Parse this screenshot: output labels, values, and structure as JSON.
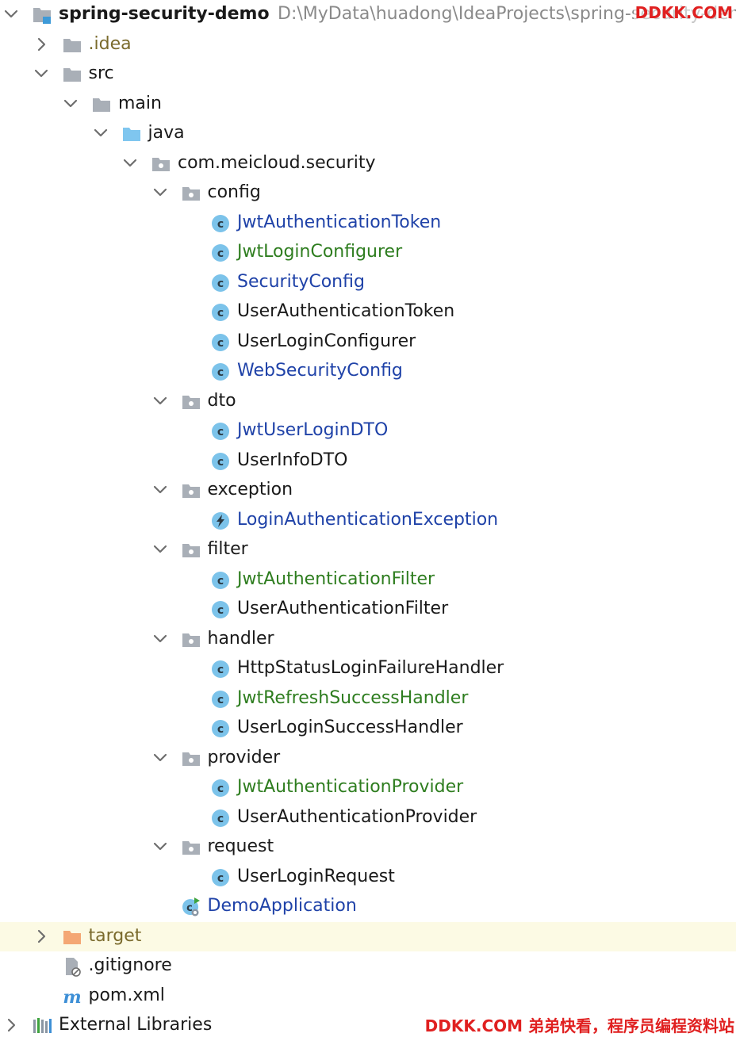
{
  "colors": {
    "default": "#1a1a1a",
    "modified": "#1f42a8",
    "added": "#2e7d1f",
    "excluded": "#7a6a2c",
    "path": "#8a8a8a",
    "row_highlight": "#fcfae4",
    "class_icon": "#7cc3ea",
    "folder": "#a9afb7",
    "source_folder": "#7fc6ef",
    "excluded_folder": "#f4a774",
    "watermark": "#e02020"
  },
  "project": {
    "name": "spring-security-demo",
    "path": "D:\\MyData\\huadong\\IdeaProjects\\spring-security-demo"
  },
  "watermark": {
    "top": "DDKK.COM",
    "bottom": "DDKK.COM 弟弟快看，程序员编程资料站"
  },
  "nodes": [
    {
      "label": "spring-security-demo",
      "depth": 0,
      "expander": "open",
      "icon": "module-folder-icon",
      "color": "default",
      "bold": true,
      "name": "project-root"
    },
    {
      "label": ".idea",
      "depth": 1,
      "expander": "closed",
      "icon": "folder-icon",
      "color": "excluded",
      "name": "tree-item-idea"
    },
    {
      "label": "src",
      "depth": 1,
      "expander": "open",
      "icon": "folder-icon",
      "color": "default",
      "name": "tree-item-src"
    },
    {
      "label": "main",
      "depth": 2,
      "expander": "open",
      "icon": "folder-icon",
      "color": "default",
      "name": "tree-item-main"
    },
    {
      "label": "java",
      "depth": 3,
      "expander": "open",
      "icon": "source-folder-icon",
      "color": "default",
      "name": "tree-item-java"
    },
    {
      "label": "com.meicloud.security",
      "depth": 4,
      "expander": "open",
      "icon": "package-icon",
      "color": "default",
      "name": "tree-item-package-root"
    },
    {
      "label": "config",
      "depth": 5,
      "expander": "open",
      "icon": "package-icon",
      "color": "default",
      "name": "tree-item-config"
    },
    {
      "label": "JwtAuthenticationToken",
      "depth": 6,
      "expander": "none",
      "icon": "class-icon",
      "color": "modified",
      "name": "tree-item-class"
    },
    {
      "label": "JwtLoginConfigurer",
      "depth": 6,
      "expander": "none",
      "icon": "class-icon",
      "color": "added",
      "name": "tree-item-class"
    },
    {
      "label": "SecurityConfig",
      "depth": 6,
      "expander": "none",
      "icon": "class-icon",
      "color": "modified",
      "name": "tree-item-class"
    },
    {
      "label": "UserAuthenticationToken",
      "depth": 6,
      "expander": "none",
      "icon": "class-icon",
      "color": "default",
      "name": "tree-item-class"
    },
    {
      "label": "UserLoginConfigurer",
      "depth": 6,
      "expander": "none",
      "icon": "class-icon",
      "color": "default",
      "name": "tree-item-class"
    },
    {
      "label": "WebSecurityConfig",
      "depth": 6,
      "expander": "none",
      "icon": "class-icon",
      "color": "modified",
      "name": "tree-item-class"
    },
    {
      "label": "dto",
      "depth": 5,
      "expander": "open",
      "icon": "package-icon",
      "color": "default",
      "name": "tree-item-dto"
    },
    {
      "label": "JwtUserLoginDTO",
      "depth": 6,
      "expander": "none",
      "icon": "class-icon",
      "color": "modified",
      "name": "tree-item-class"
    },
    {
      "label": "UserInfoDTO",
      "depth": 6,
      "expander": "none",
      "icon": "class-icon",
      "color": "default",
      "name": "tree-item-class"
    },
    {
      "label": "exception",
      "depth": 5,
      "expander": "open",
      "icon": "package-icon",
      "color": "default",
      "name": "tree-item-exception"
    },
    {
      "label": "LoginAuthenticationException",
      "depth": 6,
      "expander": "none",
      "icon": "exception-class-icon",
      "color": "modified",
      "name": "tree-item-class"
    },
    {
      "label": "filter",
      "depth": 5,
      "expander": "open",
      "icon": "package-icon",
      "color": "default",
      "name": "tree-item-filter"
    },
    {
      "label": "JwtAuthenticationFilter",
      "depth": 6,
      "expander": "none",
      "icon": "class-icon",
      "color": "added",
      "name": "tree-item-class"
    },
    {
      "label": "UserAuthenticationFilter",
      "depth": 6,
      "expander": "none",
      "icon": "class-icon",
      "color": "default",
      "name": "tree-item-class"
    },
    {
      "label": "handler",
      "depth": 5,
      "expander": "open",
      "icon": "package-icon",
      "color": "default",
      "name": "tree-item-handler"
    },
    {
      "label": "HttpStatusLoginFailureHandler",
      "depth": 6,
      "expander": "none",
      "icon": "class-icon",
      "color": "default",
      "name": "tree-item-class"
    },
    {
      "label": "JwtRefreshSuccessHandler",
      "depth": 6,
      "expander": "none",
      "icon": "class-icon",
      "color": "added",
      "name": "tree-item-class"
    },
    {
      "label": "UserLoginSuccessHandler",
      "depth": 6,
      "expander": "none",
      "icon": "class-icon",
      "color": "default",
      "name": "tree-item-class"
    },
    {
      "label": "provider",
      "depth": 5,
      "expander": "open",
      "icon": "package-icon",
      "color": "default",
      "name": "tree-item-provider"
    },
    {
      "label": "JwtAuthenticationProvider",
      "depth": 6,
      "expander": "none",
      "icon": "class-icon",
      "color": "added",
      "name": "tree-item-class"
    },
    {
      "label": "UserAuthenticationProvider",
      "depth": 6,
      "expander": "none",
      "icon": "class-icon",
      "color": "default",
      "name": "tree-item-class"
    },
    {
      "label": "request",
      "depth": 5,
      "expander": "open",
      "icon": "package-icon",
      "color": "default",
      "name": "tree-item-request"
    },
    {
      "label": "UserLoginRequest",
      "depth": 6,
      "expander": "none",
      "icon": "class-icon",
      "color": "default",
      "name": "tree-item-class"
    },
    {
      "label": "DemoApplication",
      "depth": 5,
      "expander": "none",
      "icon": "spring-boot-app-icon",
      "color": "modified",
      "name": "tree-item-app"
    },
    {
      "label": "target",
      "depth": 1,
      "expander": "closed",
      "icon": "excluded-folder-icon",
      "color": "excluded",
      "highlight": true,
      "name": "tree-item-target"
    },
    {
      "label": ".gitignore",
      "depth": 1,
      "expander": "none",
      "icon": "ignore-file-icon",
      "color": "default",
      "name": "tree-item-gitignore"
    },
    {
      "label": "pom.xml",
      "depth": 1,
      "expander": "none",
      "icon": "maven-icon",
      "color": "default",
      "name": "tree-item-pom"
    },
    {
      "label": "External Libraries",
      "depth": 0,
      "expander": "closed",
      "icon": "libraries-icon",
      "color": "default",
      "name": "tree-item-external-libraries"
    }
  ]
}
